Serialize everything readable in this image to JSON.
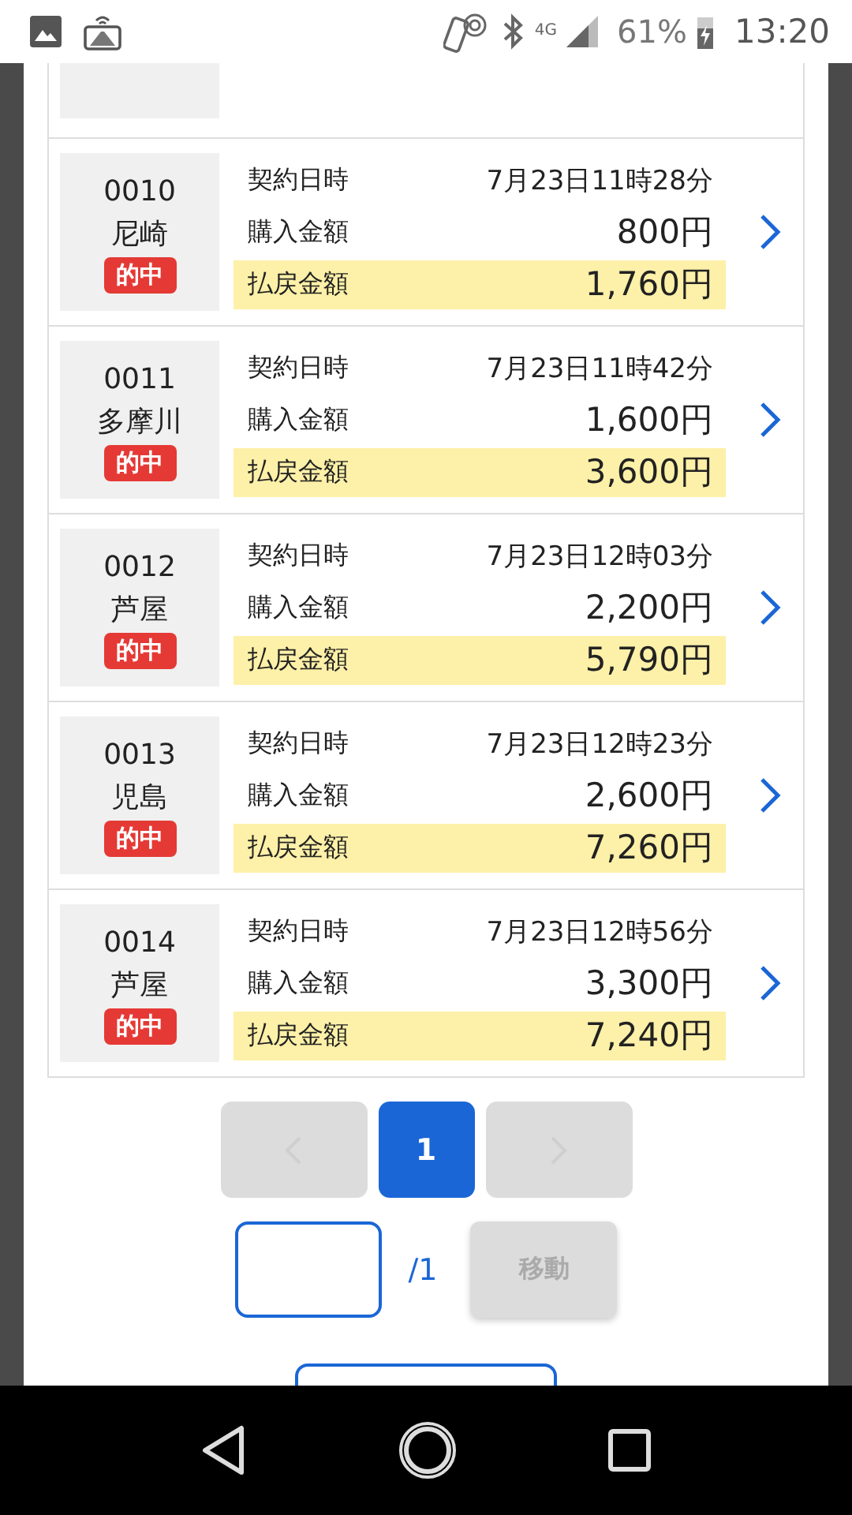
{
  "status_bar": {
    "network": "4G",
    "battery": "61%",
    "time": "13:20"
  },
  "records": [
    {
      "number": "0010",
      "venue": "尼崎",
      "badge": "的中",
      "rows": [
        {
          "kind": "plain",
          "label": "契約日時",
          "value": "7月23日11時28分"
        },
        {
          "kind": "plain",
          "label": "購入金額",
          "value": "800円"
        },
        {
          "kind": "payout",
          "label": "払戻金額",
          "value": "1,760円"
        }
      ]
    },
    {
      "number": "0011",
      "venue": "多摩川",
      "badge": "的中",
      "rows": [
        {
          "kind": "plain",
          "label": "契約日時",
          "value": "7月23日11時42分"
        },
        {
          "kind": "plain",
          "label": "購入金額",
          "value": "1,600円"
        },
        {
          "kind": "payout",
          "label": "払戻金額",
          "value": "3,600円"
        }
      ]
    },
    {
      "number": "0012",
      "venue": "芦屋",
      "badge": "的中",
      "rows": [
        {
          "kind": "plain",
          "label": "契約日時",
          "value": "7月23日12時03分"
        },
        {
          "kind": "plain",
          "label": "購入金額",
          "value": "2,200円"
        },
        {
          "kind": "payout",
          "label": "払戻金額",
          "value": "5,790円"
        }
      ]
    },
    {
      "number": "0013",
      "venue": "児島",
      "badge": "的中",
      "rows": [
        {
          "kind": "plain",
          "label": "契約日時",
          "value": "7月23日12時23分"
        },
        {
          "kind": "plain",
          "label": "購入金額",
          "value": "2,600円"
        },
        {
          "kind": "payout",
          "label": "払戻金額",
          "value": "7,260円"
        }
      ]
    },
    {
      "number": "0014",
      "venue": "芦屋",
      "badge": "的中",
      "rows": [
        {
          "kind": "plain",
          "label": "契約日時",
          "value": "7月23日12時56分"
        },
        {
          "kind": "plain",
          "label": "購入金額",
          "value": "3,300円"
        },
        {
          "kind": "payout",
          "label": "払戻金額",
          "value": "7,240円"
        }
      ]
    }
  ],
  "pagination": {
    "prev_disabled": true,
    "next_disabled": true,
    "pages": [
      {
        "label": "1",
        "selected": true
      }
    ]
  },
  "jump": {
    "total": "/1",
    "button": "移動",
    "button_disabled": true
  }
}
